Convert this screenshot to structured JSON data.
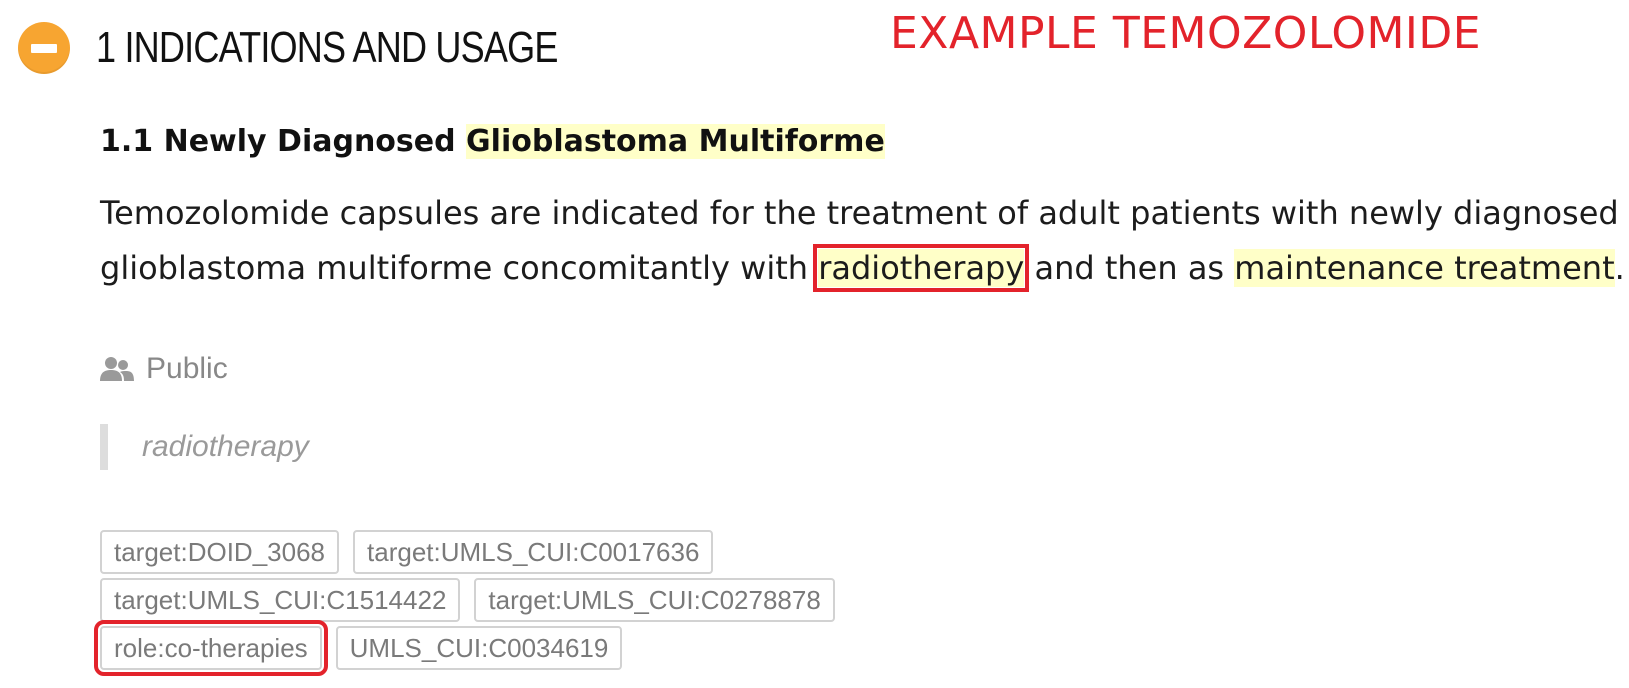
{
  "section": {
    "title": "1 INDICATIONS AND USAGE",
    "collapse_icon": "minus-circle-icon",
    "accent_color": "#f7a531"
  },
  "example_label": "EXAMPLE TEMOZOLOMIDE",
  "subsection": {
    "prefix": "1.1 Newly Diagnosed ",
    "highlight": "Glioblastoma Multiforme"
  },
  "paragraph": {
    "line1": "Temozolomide capsules are indicated for the treatment of adult patients with newly diagnosed",
    "line2_a": "glioblastoma multiforme concomitantly with ",
    "line2_highlight_boxed": "radiotherapy",
    "line2_b": " and then as ",
    "line2_highlight": "maintenance treatment",
    "line2_end": "."
  },
  "annotation": {
    "visibility_icon": "users-icon",
    "visibility": "Public",
    "quote": "radiotherapy"
  },
  "tags": [
    [
      "target:DOID_3068",
      "target:UMLS_CUI:C0017636"
    ],
    [
      "target:UMLS_CUI:C1514422",
      "target:UMLS_CUI:C0278878"
    ],
    [
      "role:co-therapies",
      "UMLS_CUI:C0034619"
    ]
  ],
  "colors": {
    "highlight": "#ffffc8",
    "annotation_box": "#e3232b",
    "example_label": "#e3232b"
  }
}
